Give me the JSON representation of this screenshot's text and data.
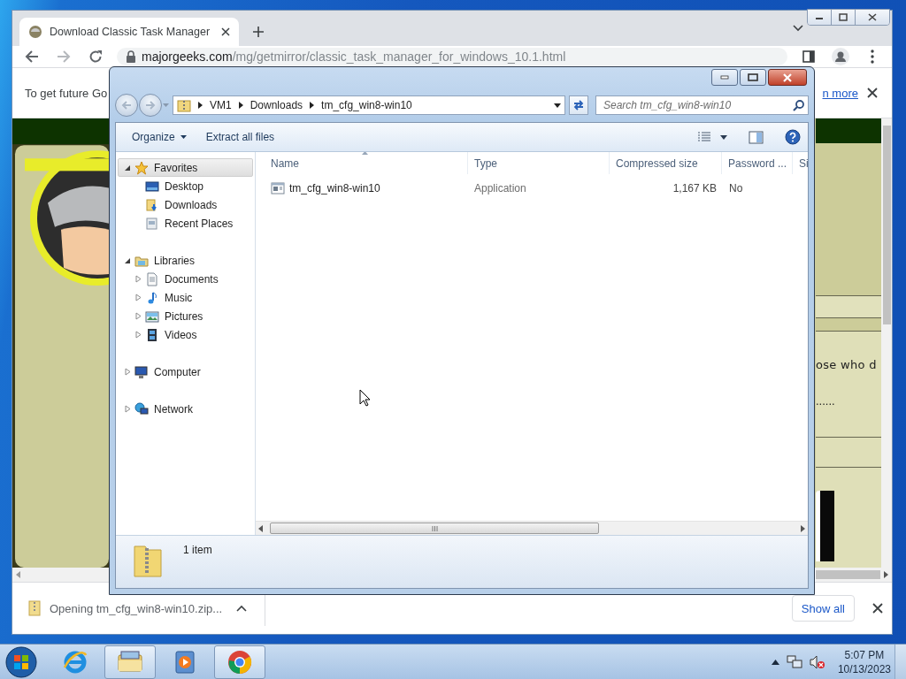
{
  "browser": {
    "tab": {
      "title": "Download Classic Task Manager"
    },
    "address": {
      "host": "majorgeeks.com",
      "path": "/mg/getmirror/classic_task_manager_for_windows_10.1.html"
    },
    "infobar": {
      "text": "To get future Go",
      "link": "n more"
    },
    "page": {
      "text_1": "ose who d",
      "text_2": "......"
    },
    "download": {
      "file": "Opening tm_cfg_win8-win10.zip...",
      "button": "Show all"
    }
  },
  "explorer": {
    "breadcrumb": [
      "VM1",
      "Downloads",
      "tm_cfg_win8-win10"
    ],
    "search": {
      "placeholder": "Search tm_cfg_win8-win10"
    },
    "commands": [
      {
        "label": "Organize",
        "menu": true
      },
      {
        "label": "Extract all files",
        "menu": false
      }
    ],
    "nav": [
      {
        "label": "Favorites",
        "kind": "favorites",
        "expanded": true,
        "selected": true,
        "children": [
          {
            "label": "Desktop",
            "kind": "desktop",
            "selected": false
          },
          {
            "label": "Downloads",
            "kind": "downloads",
            "selected": false
          },
          {
            "label": "Recent Places",
            "kind": "recent",
            "selected": false
          }
        ]
      },
      {
        "label": "Libraries",
        "kind": "libraries",
        "expanded": true,
        "selected": false,
        "children": [
          {
            "label": "Documents",
            "kind": "documents",
            "expanded": false,
            "selected": false
          },
          {
            "label": "Music",
            "kind": "music",
            "expanded": false,
            "selected": false
          },
          {
            "label": "Pictures",
            "kind": "pictures",
            "expanded": false,
            "selected": false
          },
          {
            "label": "Videos",
            "kind": "videos",
            "expanded": false,
            "selected": false
          }
        ]
      },
      {
        "label": "Computer",
        "kind": "computer",
        "expanded": false,
        "selected": false
      },
      {
        "label": "Network",
        "kind": "network",
        "expanded": false,
        "selected": false
      }
    ],
    "columns": [
      "Name",
      "Type",
      "Compressed size",
      "Password ...",
      "Si"
    ],
    "rows": [
      {
        "name": "tm_cfg_win8-win10",
        "type": "Application",
        "compressed_size": "1,167 KB",
        "password": "No",
        "selected": false
      }
    ],
    "status": "1 item"
  },
  "taskbar": {
    "buttons": [
      {
        "kind": "ie",
        "active": false
      },
      {
        "kind": "explorer",
        "active": true
      },
      {
        "kind": "media",
        "active": false
      },
      {
        "kind": "chrome",
        "active": true
      }
    ],
    "clock": {
      "time": "5:07 PM",
      "date": "10/13/2023"
    }
  }
}
